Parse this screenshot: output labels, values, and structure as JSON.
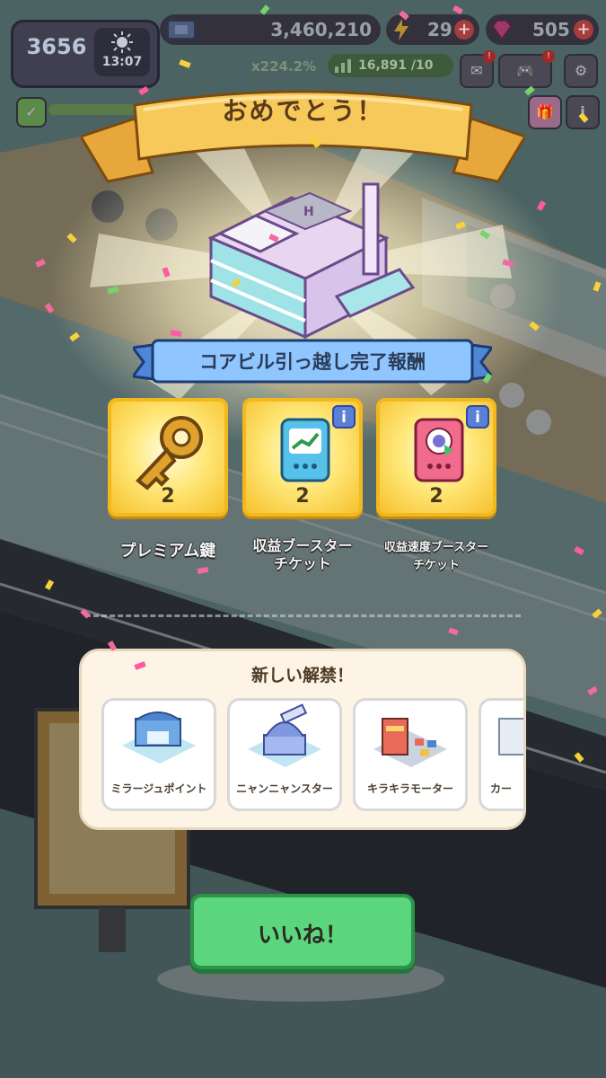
{
  "hud": {
    "level": "3656",
    "clock_time": "13:07",
    "money": "3,460,210",
    "energy": "29",
    "gems": "505",
    "multiplier": "x224.2%",
    "progress_text": "16,891 /10"
  },
  "popup": {
    "title": "おめでとう！",
    "banner": "コアビル引っ越し完了報酬",
    "rewards": [
      {
        "label_line1": "プレミアム鍵",
        "label_line2": "",
        "count": "2",
        "icon": "golden-key-icon"
      },
      {
        "label_line1": "収益ブースター",
        "label_line2": "チケット",
        "count": "2",
        "icon": "income-booster-ticket-icon"
      },
      {
        "label_line1": "収益速度ブースター",
        "label_line2": "チケット",
        "count": "2",
        "icon": "speed-booster-ticket-icon"
      }
    ],
    "unlock_title": "新しい解禁！",
    "unlocks": [
      {
        "label": "ミラージュポイント"
      },
      {
        "label": "ニャンニャンスター"
      },
      {
        "label": "キラキラモーター"
      },
      {
        "label": "カー"
      }
    ],
    "ok_button": "いいね！"
  },
  "colors": {
    "ok_green": "#5cd67e",
    "ribbon_gold": "#f7c95a",
    "banner_blue": "#8fc6ff",
    "reward_gold": "#ffe87a"
  }
}
